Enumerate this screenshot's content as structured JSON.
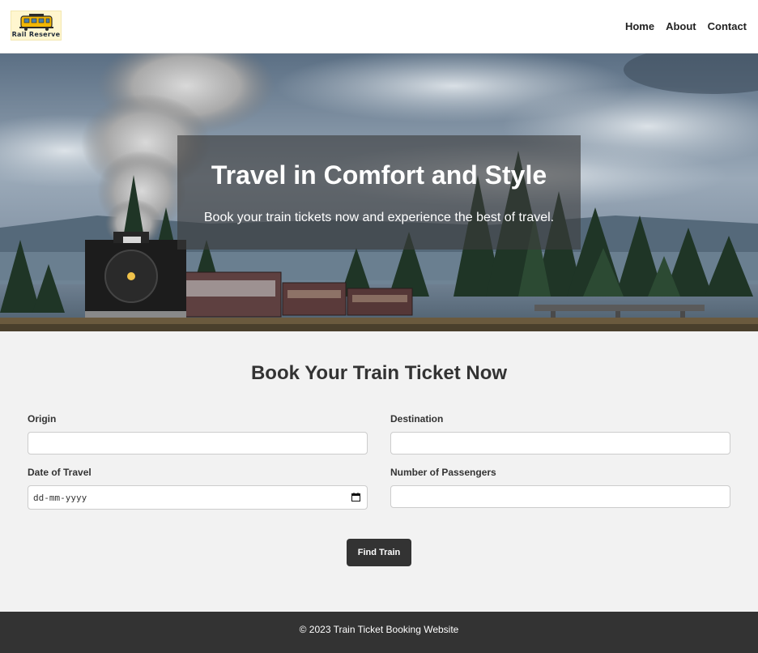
{
  "header": {
    "logo_text": "Rail Reserve",
    "nav": [
      {
        "label": "Home"
      },
      {
        "label": "About"
      },
      {
        "label": "Contact"
      }
    ]
  },
  "hero": {
    "title": "Travel in Comfort and Style",
    "subtitle": "Book your train tickets now and experience the best of travel."
  },
  "booking": {
    "title": "Book Your Train Ticket Now",
    "fields": {
      "origin": {
        "label": "Origin",
        "value": ""
      },
      "destination": {
        "label": "Destination",
        "value": ""
      },
      "date": {
        "label": "Date of Travel",
        "placeholder": "dd-mm-yyyy"
      },
      "passengers": {
        "label": "Number of Passengers",
        "value": ""
      }
    },
    "submit_label": "Find Train"
  },
  "footer": {
    "text": "© 2023 Train Ticket Booking Website"
  },
  "icons": {
    "logo": "train-logo-icon",
    "date": "calendar-icon"
  },
  "colors": {
    "header_bg": "#ffffff",
    "page_bg": "#f2f2f2",
    "button_bg": "#333333",
    "footer_bg": "#333333",
    "overlay": "rgba(60,60,60,0.62)"
  }
}
